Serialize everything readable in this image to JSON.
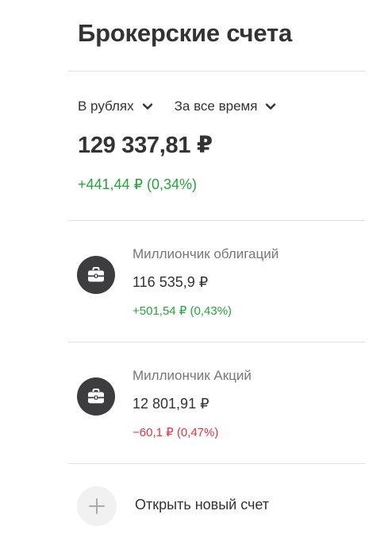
{
  "header": {
    "title": "Брокерские счета"
  },
  "filters": {
    "currency": {
      "label": "В рублях",
      "icon": "chevron-down-icon"
    },
    "period": {
      "label": "За все время",
      "icon": "chevron-down-icon"
    }
  },
  "summary": {
    "total": "129 337,81 ₽",
    "change": "+441,44 ₽ (0,34%)"
  },
  "accounts": [
    {
      "name": "Миллиончик облигаций",
      "value": "116 535,9 ₽",
      "change": "+501,54 ₽ (0,43%)",
      "icon": "briefcase-icon"
    },
    {
      "name": "Миллиончик Акций",
      "value": "12 801,91 ₽",
      "change": "−60,1 ₽ (0,47%)",
      "icon": "briefcase-icon"
    }
  ],
  "open_account": {
    "label": "Открыть новый счет",
    "icon": "plus-icon"
  },
  "colors": {
    "positive": "#24a639",
    "negative": "#f0303c",
    "text": "#333333",
    "muted": "#777777",
    "icon_bg": "#3d3d3f",
    "divider": "#e0e0e0"
  }
}
